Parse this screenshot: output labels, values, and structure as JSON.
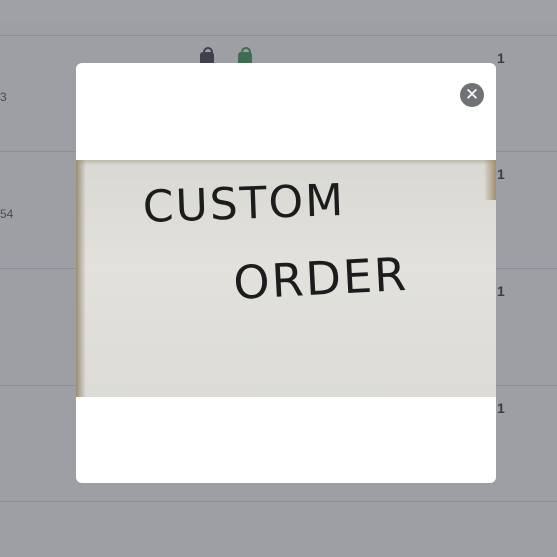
{
  "table": {
    "rows": [
      {
        "number": "3",
        "quantity": "1"
      },
      {
        "number": "54",
        "quantity": "1"
      },
      {
        "number": "",
        "quantity": "1"
      },
      {
        "number": "",
        "quantity": "1"
      }
    ],
    "icons": [
      "shopping-bag-icon",
      "shopping-bag-green-icon"
    ]
  },
  "modal": {
    "close_label": "✕",
    "image": {
      "line_1": "CUSTOM",
      "line_2": "ORDER"
    }
  },
  "colors": {
    "overlay": "#50545c",
    "close_button": "#6f7377",
    "bag_dark": "#2b2b33",
    "bag_green": "#2e8b47"
  }
}
